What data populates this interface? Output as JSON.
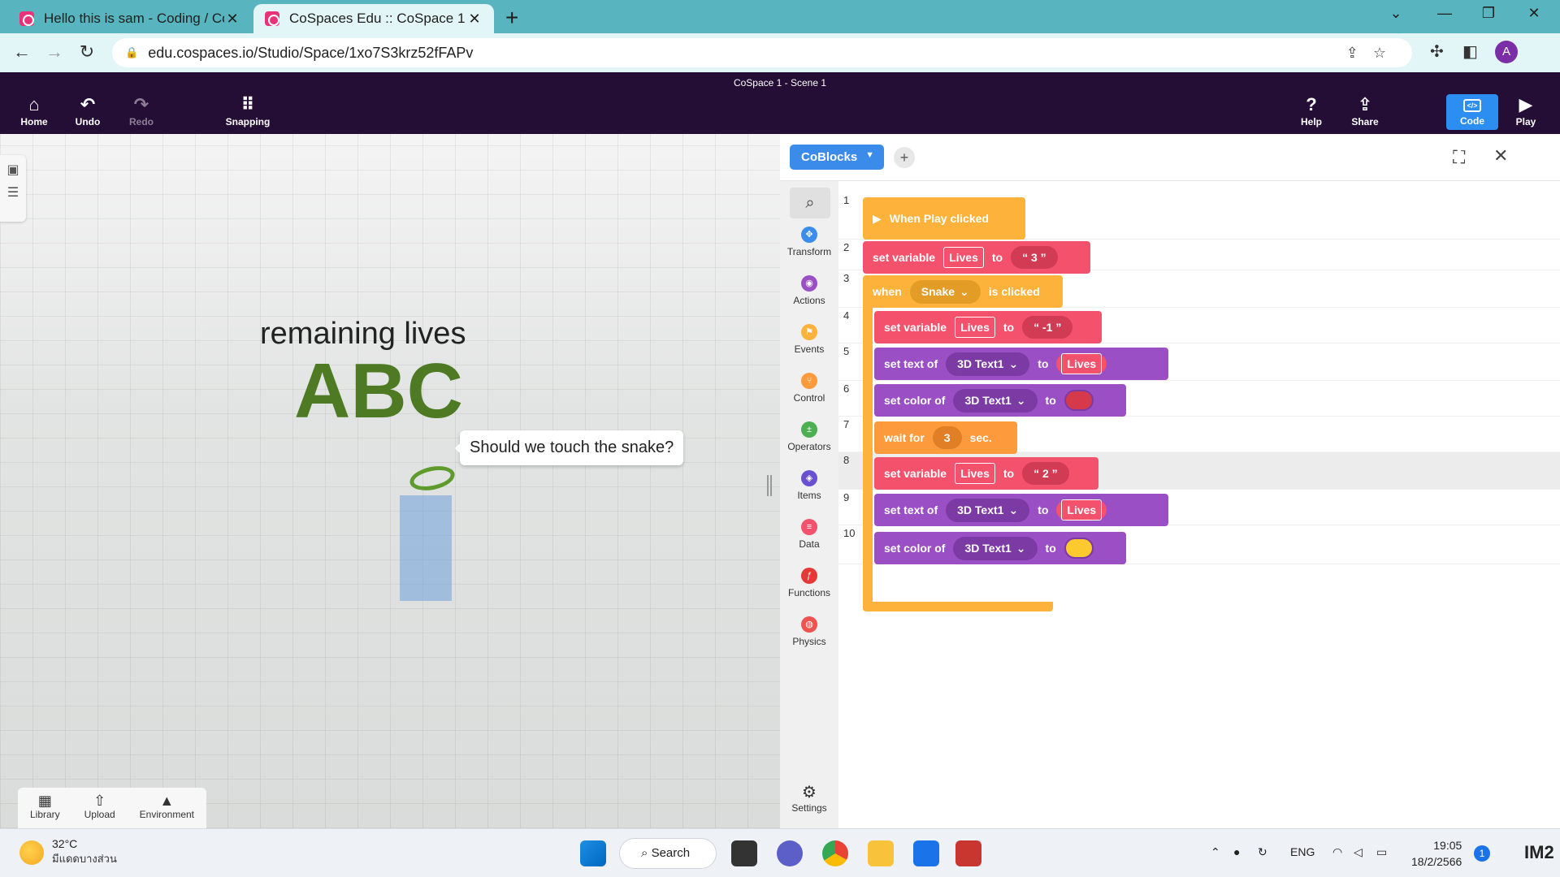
{
  "browser": {
    "tabs": [
      {
        "label": "Hello this is sam - Coding / CoBl",
        "active": false
      },
      {
        "label": "CoSpaces Edu :: CoSpace 1",
        "active": true
      }
    ],
    "new_tab": "+",
    "url": "edu.cospaces.io/Studio/Space/1xo7S3krz52fFAPv",
    "profile_initial": "A"
  },
  "app": {
    "scene_title": "CoSpace 1 - Scene 1",
    "header_left": [
      {
        "label": "Home",
        "icon": "home-icon",
        "glyph": "⌂"
      },
      {
        "label": "Undo",
        "icon": "undo-icon",
        "glyph": "↶"
      },
      {
        "label": "Redo",
        "icon": "redo-icon",
        "glyph": "↷"
      },
      {
        "label": "Snapping",
        "icon": "grid-icon",
        "glyph": "⠿"
      }
    ],
    "header_right": [
      {
        "label": "Help",
        "icon": "help-icon",
        "glyph": "?"
      },
      {
        "label": "Share",
        "icon": "share-icon",
        "glyph": "⇪"
      },
      {
        "label": "Code",
        "icon": "code-icon",
        "glyph": "</>"
      },
      {
        "label": "Play",
        "icon": "play-icon",
        "glyph": "▶"
      }
    ]
  },
  "scene": {
    "text_3d_top": "remaining  lives",
    "text_3d_big": "ABC",
    "speech_bubble": "Should we touch the snake?",
    "bottom_tools": [
      {
        "label": "Library",
        "glyph": "▦"
      },
      {
        "label": "Upload",
        "glyph": "⇧"
      },
      {
        "label": "Environment",
        "glyph": "▲"
      }
    ]
  },
  "code_panel": {
    "coblocks_label": "CoBlocks",
    "categories": [
      {
        "label": "Transform",
        "color": "#3b8bea",
        "glyph": "✥"
      },
      {
        "label": "Actions",
        "color": "#9b4fc5",
        "glyph": "◉"
      },
      {
        "label": "Events",
        "color": "#fdb23b",
        "glyph": "⚑"
      },
      {
        "label": "Control",
        "color": "#fd9a3b",
        "glyph": "⑂"
      },
      {
        "label": "Operators",
        "color": "#4caf50",
        "glyph": "±"
      },
      {
        "label": "Items",
        "color": "#6a4fd0",
        "glyph": "◈"
      },
      {
        "label": "Data",
        "color": "#f4516c",
        "glyph": "≡"
      },
      {
        "label": "Functions",
        "color": "#e53935",
        "glyph": "ƒ"
      },
      {
        "label": "Physics",
        "color": "#ef5350",
        "glyph": "◍"
      }
    ],
    "settings_label": "Settings",
    "line_numbers": [
      "1",
      "2",
      "3",
      "4",
      "5",
      "6",
      "7",
      "8",
      "9",
      "10"
    ],
    "blocks": {
      "b1": {
        "text": "When Play clicked"
      },
      "b2": {
        "a": "set variable",
        "var": "Lives",
        "b": "to",
        "val": "“  3  ”"
      },
      "b3": {
        "a": "when",
        "obj": "Snake",
        "b": "is clicked"
      },
      "b4": {
        "a": "set variable",
        "var": "Lives",
        "b": "to",
        "val": "“  -1  ”"
      },
      "b5": {
        "a": "set text of",
        "obj": "3D Text1",
        "b": "to",
        "var": "Lives"
      },
      "b6": {
        "a": "set color of",
        "obj": "3D Text1",
        "b": "to",
        "color": "#d63a4a"
      },
      "b7": {
        "a": "wait for",
        "num": "3",
        "b": "sec."
      },
      "b8": {
        "a": "set variable",
        "var": "Lives",
        "b": "to",
        "val": "“  2  ”"
      },
      "b9": {
        "a": "set text of",
        "obj": "3D Text1",
        "b": "to",
        "var": "Lives"
      },
      "b10": {
        "a": "set color of",
        "obj": "3D Text1",
        "b": "to",
        "color": "#fcc92e"
      }
    },
    "zoom_in": "+",
    "zoom_out": "−"
  },
  "taskbar": {
    "temperature": "32°C",
    "weather_desc": "มีแดดบางส่วน",
    "search_label": "Search",
    "language": "ENG",
    "time": "19:05",
    "date": "18/2/2566",
    "notification_count": "1",
    "corner_text": "IM2"
  }
}
